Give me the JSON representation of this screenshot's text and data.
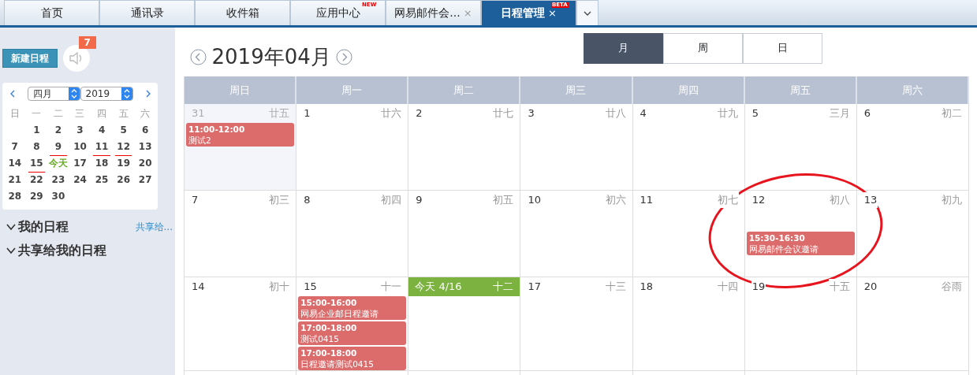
{
  "tabs": [
    {
      "label": "首页",
      "selected": false
    },
    {
      "label": "通讯录",
      "selected": false
    },
    {
      "label": "收件箱",
      "selected": false
    },
    {
      "label": "应用中心",
      "selected": false,
      "badge": "NEW"
    },
    {
      "label": "网易邮件会...",
      "selected": false,
      "close": "×"
    },
    {
      "label": "日程管理",
      "selected": true,
      "close": "×",
      "badge": "BETA"
    }
  ],
  "sidebar": {
    "new_button": "新建日程",
    "notification_count": "7",
    "mini_calendar": {
      "month": "四月",
      "year": "2019",
      "weekdays": [
        "日",
        "一",
        "二",
        "三",
        "四",
        "五",
        "六"
      ],
      "weeks": [
        [
          {
            "label": "1",
            "marked": false,
            "today": false
          },
          {
            "label": "2",
            "marked": false,
            "today": false
          },
          {
            "label": "3",
            "marked": false,
            "today": false
          },
          {
            "label": "4",
            "marked": false,
            "today": false
          },
          {
            "label": "5",
            "marked": false,
            "today": false
          },
          {
            "label": "6",
            "marked": false,
            "today": false
          }
        ],
        [
          {
            "label": "7",
            "marked": false,
            "today": false
          },
          {
            "label": "8",
            "marked": false,
            "today": false
          },
          {
            "label": "9",
            "marked": true,
            "today": false
          },
          {
            "label": "10",
            "marked": false,
            "today": false
          },
          {
            "label": "11",
            "marked": true,
            "today": false
          },
          {
            "label": "12",
            "marked": true,
            "today": false
          },
          {
            "label": "13",
            "marked": false,
            "today": false
          }
        ],
        [
          {
            "label": "14",
            "marked": false,
            "today": false
          },
          {
            "label": "15",
            "marked": true,
            "today": false
          },
          {
            "label": "今天",
            "marked": false,
            "today": true
          },
          {
            "label": "17",
            "marked": false,
            "today": false
          },
          {
            "label": "18",
            "marked": false,
            "today": false
          },
          {
            "label": "19",
            "marked": false,
            "today": false
          },
          {
            "label": "20",
            "marked": false,
            "today": false
          }
        ],
        [
          {
            "label": "21",
            "marked": false,
            "today": false
          },
          {
            "label": "22",
            "marked": false,
            "today": false
          },
          {
            "label": "23",
            "marked": false,
            "today": false
          },
          {
            "label": "24",
            "marked": false,
            "today": false
          },
          {
            "label": "25",
            "marked": false,
            "today": false
          },
          {
            "label": "26",
            "marked": false,
            "today": false
          },
          {
            "label": "27",
            "marked": false,
            "today": false
          }
        ],
        [
          {
            "label": "28",
            "marked": false,
            "today": false
          },
          {
            "label": "29",
            "marked": false,
            "today": false
          },
          {
            "label": "30",
            "marked": false,
            "today": false
          }
        ]
      ]
    },
    "sections": [
      {
        "label": "我的日程",
        "expanded": true,
        "link": "共享给..."
      },
      {
        "label": "共享给我的日程",
        "expanded": true
      }
    ]
  },
  "header": {
    "title": "2019年04月",
    "views": [
      {
        "label": "月",
        "selected": true
      },
      {
        "label": "周",
        "selected": false
      },
      {
        "label": "日",
        "selected": false
      }
    ]
  },
  "calendar": {
    "weekdays": [
      "周日",
      "周一",
      "周二",
      "周三",
      "周四",
      "周五",
      "周六"
    ],
    "weeks": [
      [
        {
          "day": "31",
          "lunar": "廿五",
          "other_month": true,
          "today": false,
          "events": [
            {
              "time": "11:00-12:00",
              "title": "测试2"
            }
          ]
        },
        {
          "day": "1",
          "lunar": "廿六",
          "other_month": false,
          "today": false
        },
        {
          "day": "2",
          "lunar": "廿七",
          "other_month": false,
          "today": false
        },
        {
          "day": "3",
          "lunar": "廿八",
          "other_month": false,
          "today": false
        },
        {
          "day": "4",
          "lunar": "廿九",
          "other_month": false,
          "today": false
        },
        {
          "day": "5",
          "lunar": "三月",
          "other_month": false,
          "today": false
        },
        {
          "day": "6",
          "lunar": "初二",
          "other_month": false,
          "today": false
        }
      ],
      [
        {
          "day": "7",
          "lunar": "初三",
          "other_month": false,
          "today": false
        },
        {
          "day": "8",
          "lunar": "初四",
          "other_month": false,
          "today": false
        },
        {
          "day": "9",
          "lunar": "初五",
          "other_month": false,
          "today": false
        },
        {
          "day": "10",
          "lunar": "初六",
          "other_month": false,
          "today": false
        },
        {
          "day": "11",
          "lunar": "初七",
          "other_month": false,
          "today": false
        },
        {
          "day": "12",
          "lunar": "初八",
          "other_month": false,
          "today": false,
          "events": [
            {
              "time": "15:30-16:30",
              "title": "网易邮件会议邀请"
            }
          ]
        },
        {
          "day": "13",
          "lunar": "初九",
          "other_month": false,
          "today": false
        }
      ],
      [
        {
          "day": "14",
          "lunar": "初十",
          "other_month": false,
          "today": false
        },
        {
          "day": "15",
          "lunar": "十一",
          "other_month": false,
          "today": false,
          "events": [
            {
              "time": "15:00-16:00",
              "title": "网易企业邮日程邀请"
            },
            {
              "time": "17:00-18:00",
              "title": "测试0415"
            },
            {
              "time": "17:00-18:00",
              "title": "日程邀请测试0415"
            }
          ]
        },
        {
          "day": "今天 4/16",
          "lunar": "十二",
          "other_month": false,
          "today": true
        },
        {
          "day": "17",
          "lunar": "十三",
          "other_month": false,
          "today": false
        },
        {
          "day": "18",
          "lunar": "十四",
          "other_month": false,
          "today": false
        },
        {
          "day": "19",
          "lunar": "十五",
          "other_month": false,
          "today": false
        },
        {
          "day": "20",
          "lunar": "谷雨",
          "other_month": false,
          "today": false
        }
      ]
    ]
  }
}
